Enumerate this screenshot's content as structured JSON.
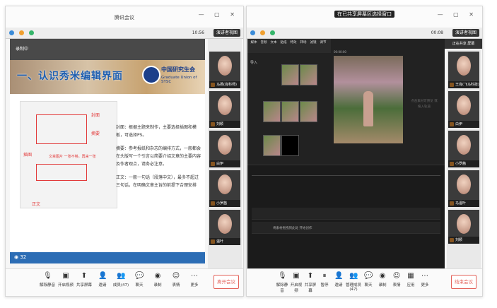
{
  "left_window": {
    "title": "腾讯会议",
    "time": "10:56",
    "layout_button": "演讲者视图",
    "recording_label": "录制中",
    "slide": {
      "title": "一、认识秀米编辑界面",
      "org_name": "中国研究生会",
      "org_sub": "Graduate Union of SYSC",
      "annotations": [
        "封面",
        "摘要",
        "正文",
        "文章图片 一张不够，再来一张",
        "插图"
      ],
      "bullets": [
        "封面：根据主题来制作，主要选择插图和模板，可选择PS。",
        "摘要：参考报纸和杂志的编排方式，一般都会在头版写一个引言以简要介绍文章的主要内容及作者观点，请务必注意。",
        "正文：一般一句话（段落中文），最多不超过三句话，在明确文章主旨的前提下合理安排"
      ],
      "bottom_label": "◉ 32"
    },
    "participants": [
      {
        "name": "马扬(肖科师)"
      },
      {
        "name": "刘颖"
      },
      {
        "name": "白伊"
      },
      {
        "name": "小罗茜"
      },
      {
        "name": "温叶"
      }
    ],
    "toolbar": [
      {
        "label": "解除静音",
        "icon": "mic-icon"
      },
      {
        "label": "开启视频",
        "icon": "camera-icon"
      },
      {
        "label": "共享屏幕",
        "icon": "screen-share-icon"
      },
      {
        "label": "邀请",
        "icon": "invite-icon"
      },
      {
        "label": "成员(47)",
        "icon": "members-icon"
      },
      {
        "label": "聊天",
        "icon": "chat-icon"
      },
      {
        "label": "录制",
        "icon": "record-icon"
      },
      {
        "label": "表情",
        "icon": "emoji-icon"
      },
      {
        "label": "更多",
        "icon": "more-icon"
      }
    ],
    "end_button": "离开会议"
  },
  "right_window": {
    "title": "在已共享屏幕区选择窗口",
    "time": "00:08",
    "layout_button": "演讲者视图",
    "share_pill": "正在共享 屏幕",
    "editor_tools": [
      "媒体",
      "音频",
      "文本",
      "贴纸",
      "特效",
      "转场",
      "滤镜",
      "调节"
    ],
    "media_label": "导入",
    "preview_time": "00:00:00",
    "preview_hint": "点击素材可预览 或拖入轨道",
    "timeline_hint": "将素材拖拽到此处 开始创作",
    "participants": [
      {
        "name": "王肖(飞马科技)"
      },
      {
        "name": "白伊"
      },
      {
        "name": "小罗茜"
      },
      {
        "name": "马温叶"
      },
      {
        "name": "刘颖"
      }
    ],
    "toolbar": [
      {
        "label": "解除静音",
        "icon": "mic-icon"
      },
      {
        "label": "开启视频",
        "icon": "camera-icon"
      },
      {
        "label": "共享屏幕",
        "icon": "screen-share-icon"
      },
      {
        "label": "暂停",
        "icon": "pause-icon"
      },
      {
        "label": "邀请",
        "icon": "invite-icon"
      },
      {
        "label": "管理成员(47)",
        "icon": "members-icon"
      },
      {
        "label": "聊天",
        "icon": "chat-icon"
      },
      {
        "label": "录制",
        "icon": "record-icon"
      },
      {
        "label": "表情",
        "icon": "emoji-icon"
      },
      {
        "label": "应用",
        "icon": "apps-icon"
      },
      {
        "label": "更多",
        "icon": "more-icon"
      }
    ],
    "end_button": "结束会议"
  }
}
